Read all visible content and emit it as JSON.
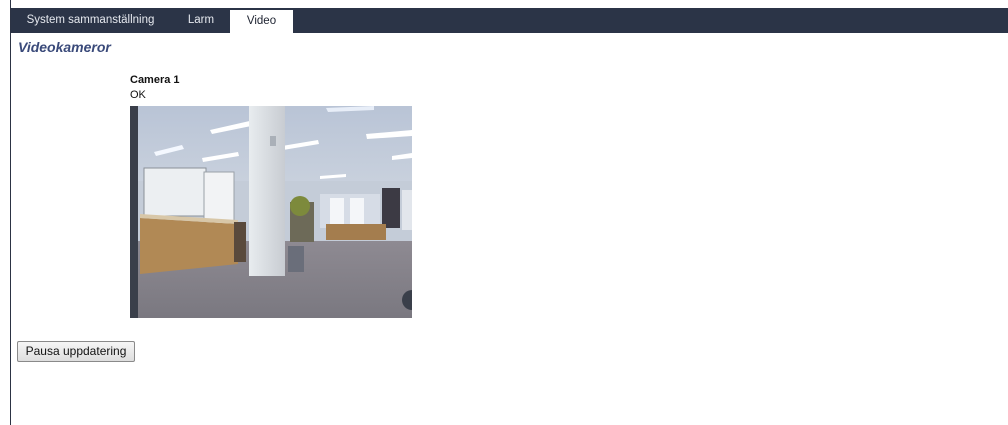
{
  "tabs": [
    {
      "label": "System sammanställning",
      "active": false
    },
    {
      "label": "Larm",
      "active": false
    },
    {
      "label": "Video",
      "active": true
    }
  ],
  "page": {
    "title": "Videokameror"
  },
  "camera": {
    "name": "Camera 1",
    "status": "OK"
  },
  "controls": {
    "pause_label": "Pausa uppdatering"
  },
  "colors": {
    "tabbar_bg": "#2b3447",
    "title_color": "#3a4a7a"
  }
}
